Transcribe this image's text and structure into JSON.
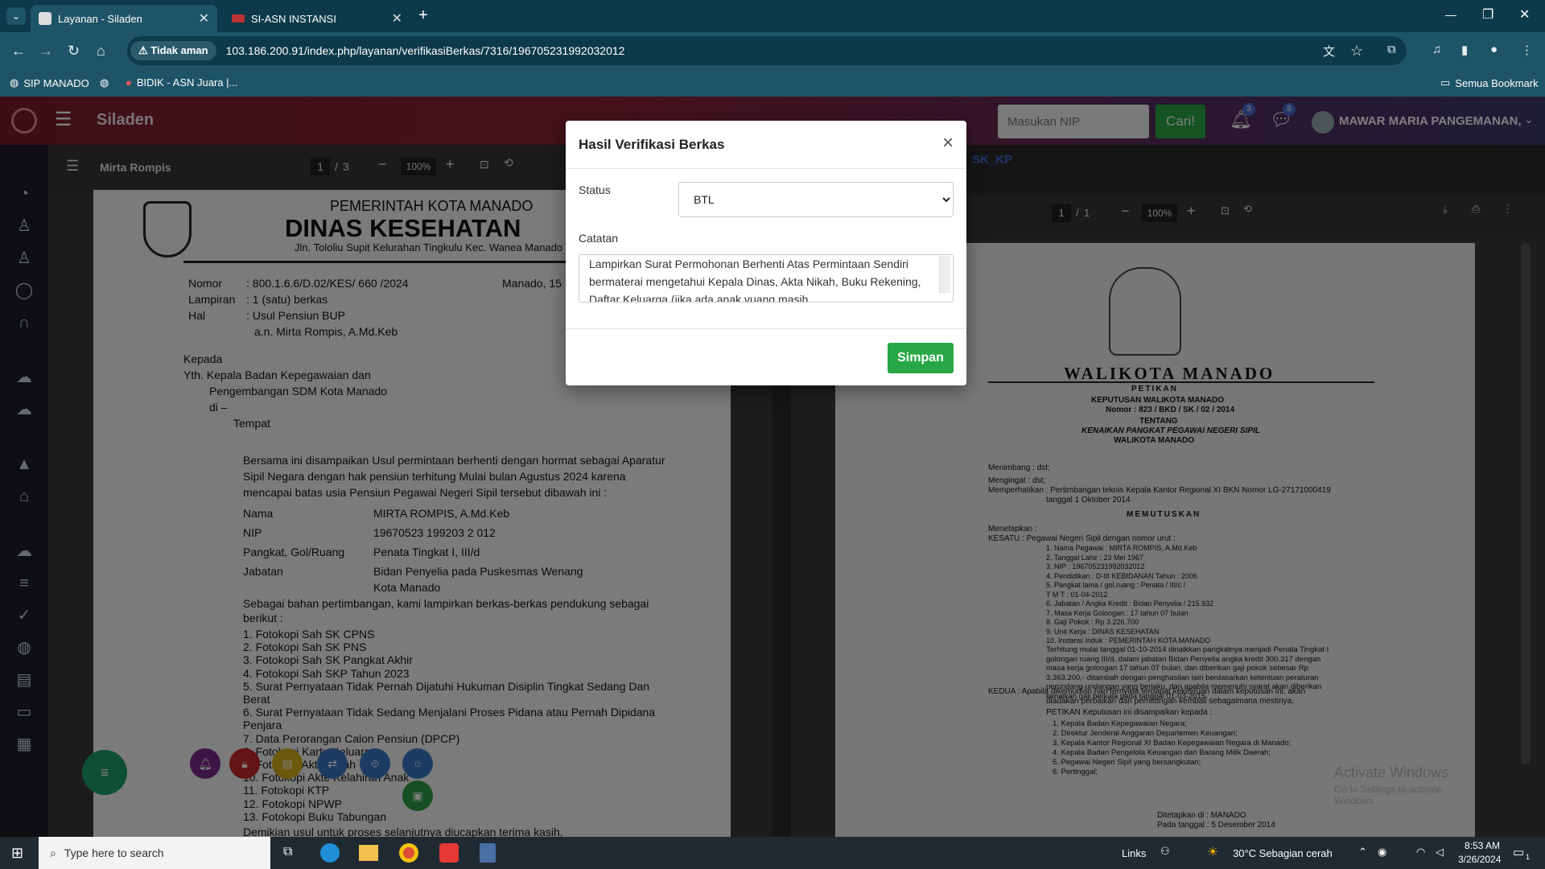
{
  "browser": {
    "tabs": [
      {
        "title": "Layanan - Siladen",
        "active": true
      },
      {
        "title": "SI-ASN INSTANSI",
        "active": false
      }
    ],
    "security_label": "Tidak aman",
    "url": "103.186.200.91/index.php/layanan/verifikasiBerkas/7316/196705231992032012",
    "bookmarks": [
      "SIP MANADO",
      "BIDIK - ASN Juara |..."
    ],
    "all_bookmarks": "Semua Bookmark"
  },
  "app": {
    "name": "Siladen",
    "nip_placeholder": "Masukan NIP",
    "search_button": "Cari!",
    "notif_count": "3",
    "msg_count": "8",
    "user_name": "MAWAR MARIA PANGEMANAN,",
    "accent": "#28a745"
  },
  "pdf_left": {
    "doc_title": "Mirta Rompis",
    "page": "1",
    "pages": "3",
    "zoom": "100%",
    "letterhead1": "PEMERINTAH KOTA MANADO",
    "letterhead2": "DINAS KESEHATAN",
    "address": "Jln. Tololiu Supit Kelurahan Tingkulu Kec. Wanea Manado",
    "nomor_label": "Nomor",
    "nomor": ": 800.1.6.6/D.02/KES/ 660 /2024",
    "city_date": "Manado, 15",
    "lampiran_label": "Lampiran",
    "lampiran": ": 1 (satu) berkas",
    "hal_label": "Hal",
    "hal": ": Usul Pensiun BUP",
    "hal2": "a.n. Mirta Rompis, A.Md.Keb",
    "kepada": "Kepada",
    "yth1": "Yth.  Kepala Badan Kepegawaian dan",
    "yth2": "Pengembangan SDM Kota Manado",
    "di": "di –",
    "tempat": "Tempat",
    "para1": "Bersama ini disampaikan Usul permintaan berhenti dengan hormat sebagai Aparatur",
    "para2": "Sipil Negara dengan hak pensiun  terhitung Mulai bulan Agustus 2024 karena",
    "para3": "mencapai batas usia Pensiun Pegawai Negeri Sipil tersebut dibawah ini :",
    "fields": [
      {
        "k": "Nama",
        "v": "MIRTA ROMPIS, A.Md.Keb"
      },
      {
        "k": "NIP",
        "v": "19670523 199203 2 012"
      },
      {
        "k": "Pangkat, Gol/Ruang",
        "v": "Penata Tingkat I, III/d"
      },
      {
        "k": "Jabatan",
        "v": "Bidan Penyelia pada Puskesmas Wenang"
      }
    ],
    "jabatan2": "Kota Manado",
    "para4": "Sebagai bahan pertimbangan, kami lampirkan berkas-berkas pendukung sebagai",
    "para5": "berikut :",
    "list": [
      "1.   Fotokopi Sah SK CPNS",
      "2.   Fotokopi Sah SK PNS",
      "3.   Fotokopi Sah SK Pangkat Akhir",
      "4.   Fotokopi Sah SKP Tahun 2023",
      "5.   Surat Pernyataan Tidak Pernah Dijatuhi Hukuman Disiplin Tingkat  Sedang Dan",
      "      Berat",
      "6.   Surat Pernyataan Tidak Sedang Menjalani Proses Pidana atau Pernah Dipidana",
      "      Penjara",
      "7.   Data Perorangan Calon Pensiun (DPCP)",
      "8.   Fotokopi Kartu Keluarga",
      "9.   Fotokopi Akta Nikah",
      "10. Fotokopi Akte Kelahiran Anak",
      "11. Fotokopi KTP",
      "12. Fotokopi NPWP",
      "13. Fotokopi Buku Tabungan"
    ],
    "closing": "Demikian usul untuk proses selanjutnya diucapkan terima kasih."
  },
  "pdf_right": {
    "link": "SK_KP",
    "page": "1",
    "pages": "1",
    "zoom": "100%",
    "title": "WALIKOTA MANADO",
    "petikan": "PETIKAN",
    "keputusan": "KEPUTUSAN WALIKOTA MANADO",
    "nomor": "Nomor : 823 / BKD / SK / 02 / 2014",
    "tentang": "TENTANG",
    "subject": "KENAIKAN PANGKAT PEGAWAI NEGERI SIPIL",
    "subject2": "WALIKOTA MANADO",
    "menimbang": "Menimbang   :  dst;",
    "mengingat": "Mengingat    :  dst;",
    "memperhatikan": "Memperhatikan :  Pertimbangan teknis Kepala Kantor Regional XI BKN Nomor LG-27171000419",
    "tanggal": "tanggal 1 Oktober 2014",
    "memutuskan": "MEMUTUSKAN",
    "menetapkan": "Menetapkan :",
    "kesatu": "KESATU  :  Pegawai Negeri Sipil dengan nomor urut :",
    "rows": [
      "1. Nama Pegawai          :  MIRTA ROMPIS, A.Md.Keb",
      "2. Tanggal Lahir           :  23 Mei 1967",
      "3. NIP                          :  196705231992032012",
      "4. Pendidikan               :  D-III KEBIDANAN Tahun : 2006",
      "5. Pangkat lama / gol.ruang :  Penata / III/c /",
      "    T M T                        :  01-04-2012",
      "6. Jabatan / Angka Kredit :  Bidan Penyelia / 215.932",
      "7. Masa Kerja Golongan   :  17 tahun 07 bulan",
      "8. Gaji Pokok                 :  Rp 3.226.700",
      "9. Unit Kerja                  :  DINAS KESEHATAN",
      "10. Instansi Induk           :  PEMERINTAH KOTA MANADO"
    ],
    "body": [
      "Terhitung mulai tanggal 01-10-2014 dinaikkan pangkatnya menjadi Penata Tingkat I",
      "golongan ruang III/d, dalam jabatan Bidan Penyelia angka kredit 300.317 dengan",
      "masa kerja golongan 17 tahun 07 bulan, dan diberikan gaji pokok sebesar Rp",
      "3.363.200,- ditambah dengan penghasilan lain berdasarkan ketentuan peraturan",
      "perundang-undangan yang berlaku, dan apabila memenuhi syarat akan diberikan",
      "kenaikan gaji berkala pada tanggal 01-03-2015."
    ],
    "kedua": "KEDUA   :  Apabila dikemudian hari ternyata terdapat kekeliruan dalam keputusan ini, akan",
    "kedua2": "diadakan perbaikan dan perhitungan kembali sebagaimana mestinya.",
    "petikan2": "PETIKAN Keputusan ini disampaikan kepada :",
    "recipients": [
      "1. Kepala Badan Kepegawaian Negara;",
      "2. Direktur Jenderal Anggaran Departemen Keuangan;",
      "3. Kepala Kantor Regional XI Badan Kepegawaian Negara di Manado;",
      "4. Kepala Badan Pengelola Keuangan dan Barang Milik Daerah;",
      "5. Pegawai Negeri Sipil yang bersangkutan;",
      "6. Pertinggal;"
    ],
    "ditetapkan": "Ditetapkan di    :  MANADO",
    "pada": "Pada tanggal    :  5 Desember 2014",
    "watermark1": "Activate Windows",
    "watermark2": "Go to Settings to activate Windows."
  },
  "modal": {
    "title": "Hasil Verifikasi Berkas",
    "status_label": "Status",
    "status_value": "BTL",
    "notes_label": "Catatan",
    "notes_value": "Lampirkan Surat Permohonan Berhenti Atas Permintaan Sendiri bermaterai mengetahui Kepala Dinas, Akta Nikah, Buku Rekening, Daftar Keluarga (jika ada anak yuang masih",
    "save_label": "Simpan"
  },
  "taskbar": {
    "search_placeholder": "Type here to search",
    "links": "Links",
    "weather": "30°C  Sebagian cerah",
    "time": "8:53 AM",
    "date": "3/26/2024",
    "notif": "1"
  }
}
